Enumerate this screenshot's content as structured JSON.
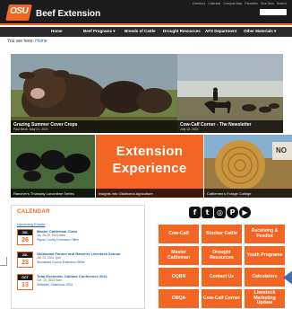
{
  "header": {
    "logo_text": "OSU",
    "site_title": "Beef Extension",
    "utility_links": [
      "Directory",
      "Calendar",
      "Campus Map",
      "Favorites",
      "Give Now",
      "Search"
    ]
  },
  "nav": {
    "items": [
      "Home",
      "Beef Programs ▾",
      "Breeds of Cattle",
      "Drought Resources",
      "AFS Department",
      "Other Materials ▾"
    ]
  },
  "breadcrumb": {
    "prefix": "You are here:",
    "home": "Home"
  },
  "hero": {
    "main_title": "Grazing Summer Cover Crops",
    "main_sub": "Paul Beck, May 21, 2021",
    "side_title": "Cow-Calf Corner - The Newsletter",
    "side_sub": "July 12, 2021"
  },
  "tiles": {
    "a_caption": "Rancher's Thursday Lunchtime Series",
    "b_title_1": "Extension",
    "b_title_2": "Experience",
    "b_caption": "Insights into Oklahoma Agriculture",
    "c_caption": "Cattlemen's Forage College",
    "c_sign": "NO"
  },
  "calendar": {
    "title": "CALENDAR",
    "subtitle": "Upcoming Events",
    "events": [
      {
        "month": "JUL",
        "day": "26",
        "name": "Master Cattleman Class",
        "date": "Jul. 26-29, 2021 8am",
        "loc": "Payne County Extension Office"
      },
      {
        "month": "JUL",
        "day": "23",
        "name": "Oklahoma Farmer and Rancher Livestock School",
        "date": "Jul. 23, 2021 7pm",
        "loc": "Woodward County Extension Office"
      },
      {
        "month": "OCT",
        "day": "13",
        "name": "Total Economic Outlook Conference 2021",
        "date": "Oct. 13, 2021 9am",
        "loc": "Stillwater, Oklahoma, OSU"
      }
    ]
  },
  "social": {
    "icons": [
      "f",
      "t",
      "◎",
      "P",
      "▶"
    ]
  },
  "buttons": [
    "Cow-Calf",
    "Stocker Cattle",
    "Receiving & Feedlot",
    "Master Cattleman",
    "Drought Resources",
    "Youth Programs",
    "OQBN",
    "Contact Us",
    "Calculators",
    "OBQA",
    "Cow-Calf Corner",
    "Livestock Marketing Update"
  ],
  "colors": {
    "brand": "#f26522",
    "header": "#1b1b1b"
  }
}
